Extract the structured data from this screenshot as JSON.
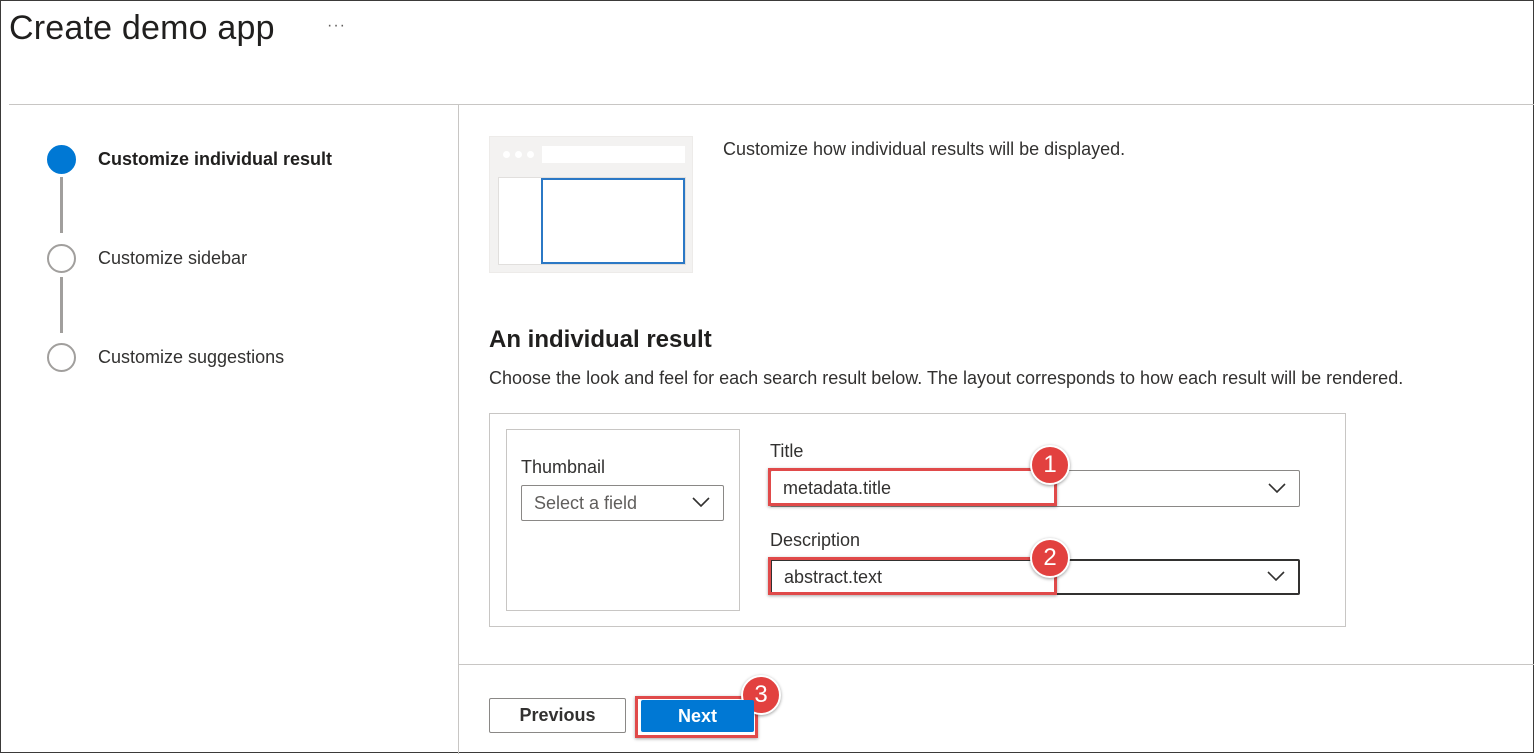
{
  "header": {
    "title": "Create demo app",
    "more_label": "···"
  },
  "stepper": {
    "steps": [
      {
        "label": "Customize individual result",
        "state": "active"
      },
      {
        "label": "Customize sidebar",
        "state": "pending"
      },
      {
        "label": "Customize suggestions",
        "state": "pending"
      }
    ]
  },
  "main": {
    "intro": "Customize how individual results will be displayed.",
    "section_title": "An individual result",
    "section_desc": "Choose the look and feel for each search result below. The layout corresponds to how each result will be rendered.",
    "thumbnail": {
      "label": "Thumbnail",
      "placeholder": "Select a field"
    },
    "title_field": {
      "label": "Title",
      "value": "metadata.title"
    },
    "description_field": {
      "label": "Description",
      "value": "abstract.text"
    }
  },
  "footer": {
    "previous_label": "Previous",
    "next_label": "Next"
  },
  "callouts": [
    "1",
    "2",
    "3"
  ],
  "colors": {
    "accent": "#0078d4",
    "callout": "#e2413f"
  }
}
